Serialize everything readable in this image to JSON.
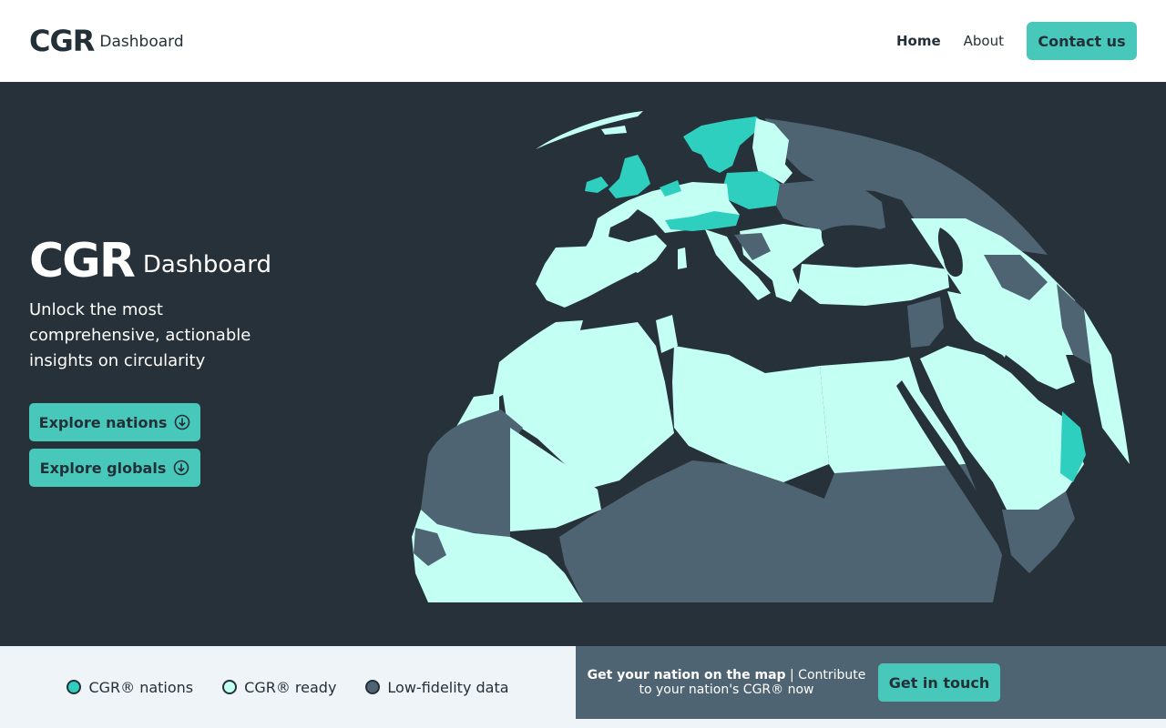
{
  "header": {
    "logo_mark": "CGR",
    "logo_sub": "Dashboard",
    "nav": [
      {
        "label": "Home",
        "active": true
      },
      {
        "label": "About",
        "active": false
      }
    ],
    "contact_label": "Contact us"
  },
  "hero": {
    "logo_mark": "CGR",
    "logo_sub": "Dashboard",
    "tagline": "Unlock the most comprehensive, actionable insights on circularity",
    "buttons": [
      {
        "label": "Explore nations",
        "icon": "arrow-down-circle-icon"
      },
      {
        "label": "Explore globals",
        "icon": "arrow-down-circle-icon"
      }
    ]
  },
  "map": {
    "colors": {
      "cgr_nations": "#2fcfc0",
      "cgr_ready": "#c4fff4",
      "low_fidelity": "#4f6473",
      "water": "#263139",
      "ocean_globe": "#263139"
    }
  },
  "legend": {
    "items": [
      {
        "label": "CGR® nations",
        "color": "#2fcfc0"
      },
      {
        "label": "CGR® ready",
        "color": "#c4fff4"
      },
      {
        "label": "Low-fidelity data",
        "color": "#4f6473"
      }
    ]
  },
  "cta": {
    "bold": "Get your nation on the map",
    "rest": " | Contribute to your nation's CGR® now",
    "button_label": "Get in touch"
  }
}
